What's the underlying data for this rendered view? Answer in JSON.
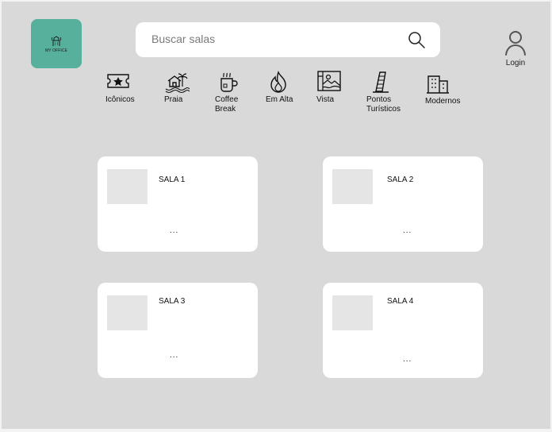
{
  "branding": {
    "logo_text": "MY OFFICE"
  },
  "search": {
    "placeholder": "Buscar salas"
  },
  "user": {
    "login_label": "Login"
  },
  "categories": [
    {
      "label": "Icônicos",
      "icon": "ticket-star-icon"
    },
    {
      "label": "Praia",
      "icon": "beach-house-icon"
    },
    {
      "label": "Coffee\nBreak",
      "icon": "coffee-cup-icon"
    },
    {
      "label": "Em Alta",
      "icon": "flame-icon"
    },
    {
      "label": "Vista",
      "icon": "landscape-icon"
    },
    {
      "label": "Pontos\nTurísticos",
      "icon": "leaning-tower-icon"
    },
    {
      "label": "Modernos",
      "icon": "modern-building-icon"
    }
  ],
  "rooms": [
    {
      "title": "SALA 1",
      "more": "..."
    },
    {
      "title": "SALA 2",
      "more": "..."
    },
    {
      "title": "SALA 3",
      "more": "..."
    },
    {
      "title": "SALA 4",
      "more": "..."
    }
  ],
  "colors": {
    "background": "#d9d9d9",
    "card": "#ffffff",
    "logo": "#57b09b",
    "thumbnail": "#e5e5e5"
  }
}
